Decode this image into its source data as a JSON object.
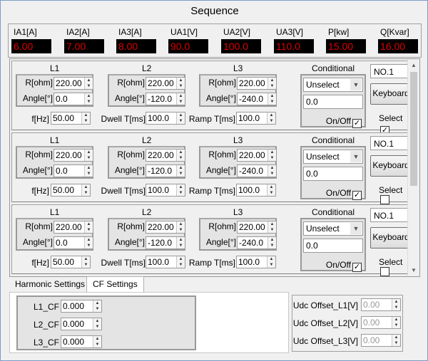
{
  "window": {
    "title": "Sequence"
  },
  "meters": [
    {
      "label": "IA1[A]",
      "value": "6.00"
    },
    {
      "label": "IA2[A]",
      "value": "7.00"
    },
    {
      "label": "IA3[A]",
      "value": "8.00"
    },
    {
      "label": "UA1[V]",
      "value": "90.0"
    },
    {
      "label": "UA2[V]",
      "value": "100.0"
    },
    {
      "label": "UA3[V]",
      "value": "110.0"
    },
    {
      "label": "P[kw]",
      "value": "15.00"
    },
    {
      "label": "Q[Kvar]",
      "value": "16.00"
    }
  ],
  "field_labels": {
    "L1": "L1",
    "L2": "L2",
    "L3": "L3",
    "r": "R[ohm]",
    "angle": "Angle[°]",
    "f": "f[Hz]",
    "dwell": "Dwell T[ms]",
    "ramp": "Ramp T[ms]",
    "conditional": "Conditional",
    "onoff": "On/Off",
    "select": "Select",
    "keyboard": "Keyboard"
  },
  "steps": [
    {
      "no": "NO.1",
      "L1": {
        "r": "220.00",
        "angle": "0.0"
      },
      "L2": {
        "r": "220.00",
        "angle": "-120.0"
      },
      "L3": {
        "r": "220.00",
        "angle": "-240.0"
      },
      "f": "50.00",
      "dwell": "100.0",
      "ramp": "100.0",
      "cond_select": "Unselect",
      "cond_value": "0.0",
      "onoff": true,
      "selected": true
    },
    {
      "no": "NO.1",
      "L1": {
        "r": "220.00",
        "angle": "0.0"
      },
      "L2": {
        "r": "220.00",
        "angle": "-120.0"
      },
      "L3": {
        "r": "220.00",
        "angle": "-240.0"
      },
      "f": "50.00",
      "dwell": "100.0",
      "ramp": "100.0",
      "cond_select": "Unselect",
      "cond_value": "0.0",
      "onoff": true,
      "selected": false
    },
    {
      "no": "NO.1",
      "L1": {
        "r": "220.00",
        "angle": "0.0"
      },
      "L2": {
        "r": "220.00",
        "angle": "-120.0"
      },
      "L3": {
        "r": "220.00",
        "angle": "-240.0"
      },
      "f": "50.00",
      "dwell": "100.0",
      "ramp": "100.0",
      "cond_select": "Unselect",
      "cond_value": "0.0",
      "onoff": true,
      "selected": false
    }
  ],
  "tabs": [
    {
      "label": "Harmonic Settings",
      "active": false
    },
    {
      "label": "CF Settings",
      "active": true
    }
  ],
  "cf": [
    {
      "label": "L1_CF",
      "value": "0.000"
    },
    {
      "label": "L2_CF",
      "value": "0.000"
    },
    {
      "label": "L3_CF",
      "value": "0.000"
    }
  ],
  "udc": [
    {
      "label": "Udc Offset_L1[V]",
      "value": "0.00"
    },
    {
      "label": "Udc Offset_L2[V]",
      "value": "0.00"
    },
    {
      "label": "Udc Offset_L3[V]",
      "value": "0.00"
    }
  ],
  "icons": {
    "spin": "spin-arrows-icon",
    "dropdown": "chevron-down-icon",
    "check": "checkmark-icon"
  }
}
